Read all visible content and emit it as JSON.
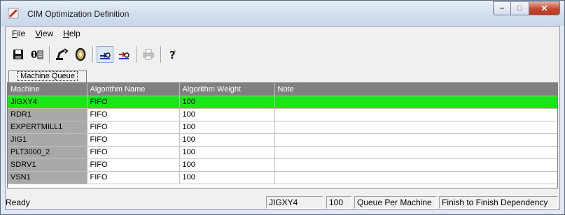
{
  "window": {
    "title": "CIM Optimization Definition",
    "caption": {
      "minimize": "–",
      "maximize": "□",
      "close": "✕"
    }
  },
  "menubar": {
    "items": [
      {
        "label": "File",
        "mnemonic": "F",
        "rest": "ile"
      },
      {
        "label": "View",
        "mnemonic": "V",
        "rest": "iew"
      },
      {
        "label": "Help",
        "mnemonic": "H",
        "rest": "elp"
      }
    ]
  },
  "toolbar": {
    "buttons": [
      {
        "icon": "save-icon"
      },
      {
        "icon": "properties-icon"
      },
      {
        "icon": "robot-arm-icon"
      },
      {
        "icon": "ring-icon"
      },
      {
        "icon": "move-right-icon"
      },
      {
        "icon": "move-left-icon"
      },
      {
        "icon": "print-icon",
        "disabled": true
      },
      {
        "icon": "help-icon"
      }
    ]
  },
  "tabs": [
    {
      "label": "Machine Queue",
      "active": true
    }
  ],
  "grid": {
    "columns": [
      "Machine",
      "Algorithm Name",
      "Algorithm Weight",
      "Note"
    ],
    "rows": [
      {
        "machine": "JIGXY4",
        "algorithm": "FIFO",
        "weight": "100",
        "note": "",
        "selected": true
      },
      {
        "machine": "RDR1",
        "algorithm": "FIFO",
        "weight": "100",
        "note": ""
      },
      {
        "machine": "EXPERTMILL1",
        "algorithm": "FIFO",
        "weight": "100",
        "note": ""
      },
      {
        "machine": "JIG1",
        "algorithm": "FIFO",
        "weight": "100",
        "note": ""
      },
      {
        "machine": "PLT3000_2",
        "algorithm": "FIFO",
        "weight": "100",
        "note": ""
      },
      {
        "machine": "SDRV1",
        "algorithm": "FIFO",
        "weight": "100",
        "note": ""
      },
      {
        "machine": "VSN1",
        "algorithm": "FIFO",
        "weight": "100",
        "note": ""
      }
    ]
  },
  "status": {
    "ready": "Ready",
    "machine": "JIGXY4",
    "weight": "100",
    "mode": "Queue Per Machine",
    "dependency": "Finish to Finish Dependency"
  },
  "colors": {
    "selected_row": "#19e619",
    "header_bg": "#808080",
    "machine_col_bg": "#a9a9a9"
  }
}
